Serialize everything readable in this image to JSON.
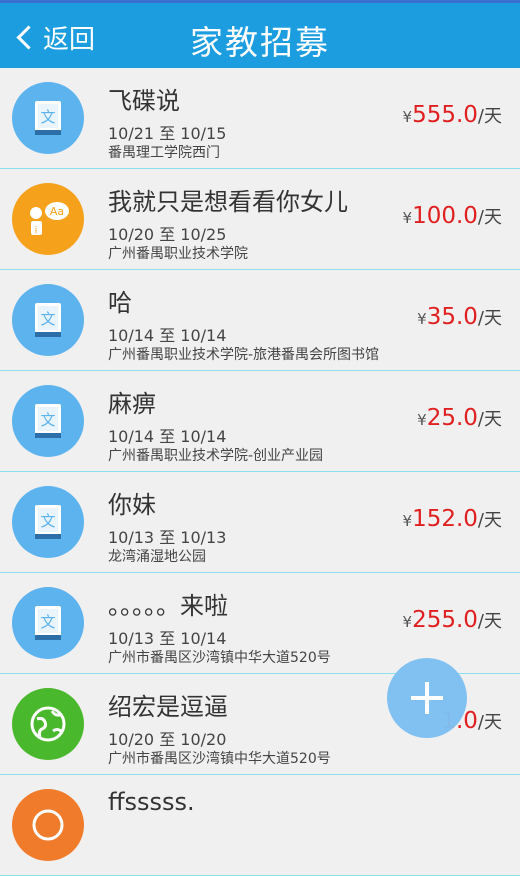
{
  "header": {
    "back_label": "返回",
    "title": "家教招募"
  },
  "listings": [
    {
      "icon": "book-icon",
      "title": "飞碟说",
      "dates": "10/21 至 10/15",
      "place": "番禺理工学院西门",
      "currency": "¥",
      "price": "555.0",
      "unit": "/天"
    },
    {
      "icon": "language-icon",
      "title": "我就只是想看看你女儿",
      "dates": "10/20 至 10/25",
      "place": "广州番禺职业技术学院",
      "currency": "¥",
      "price": "100.0",
      "unit": "/天"
    },
    {
      "icon": "book-icon",
      "title": "哈",
      "dates": "10/14 至 10/14",
      "place": "广州番禺职业技术学院-旅港番禺会所图书馆",
      "currency": "¥",
      "price": "35.0",
      "unit": "/天"
    },
    {
      "icon": "book-icon",
      "title": "麻痹",
      "dates": "10/14 至 10/14",
      "place": "广州番禺职业技术学院-创业产业园",
      "currency": "¥",
      "price": "25.0",
      "unit": "/天"
    },
    {
      "icon": "book-icon",
      "title": "你妹",
      "dates": "10/13 至 10/13",
      "place": "龙湾涌湿地公园",
      "currency": "¥",
      "price": "152.0",
      "unit": "/天"
    },
    {
      "icon": "book-icon",
      "title": "。。。。。来啦",
      "dates": "10/13 至 10/14",
      "place": "广州市番禺区沙湾镇中华大道520号",
      "currency": "¥",
      "price": "255.0",
      "unit": "/天"
    },
    {
      "icon": "globe-icon",
      "title": "绍宏是逗逼",
      "dates": "10/20 至 10/20",
      "place": "广州市番禺区沙湾镇中华大道520号",
      "currency": "",
      "price": "1.0",
      "unit": "/天"
    },
    {
      "icon": "orange-icon",
      "title": "ffsssss.",
      "dates": "",
      "place": "",
      "currency": "",
      "price": "",
      "unit": ""
    }
  ],
  "colors": {
    "header": "#1b9de0",
    "price": "#e02020",
    "divider": "#8be0f0",
    "fab": "#7ec0f3"
  },
  "fab": {
    "icon": "plus-icon"
  }
}
